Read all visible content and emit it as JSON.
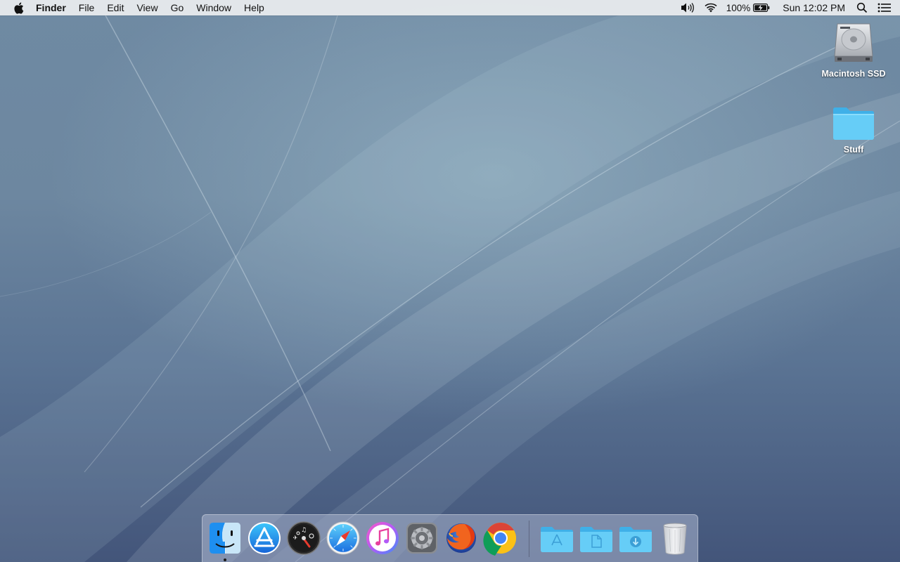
{
  "menubar": {
    "app_name": "Finder",
    "menus": [
      "File",
      "Edit",
      "View",
      "Go",
      "Window",
      "Help"
    ],
    "battery_percent": "100%",
    "clock": "Sun 12:02 PM",
    "icons": [
      "apple-icon",
      "volume-icon",
      "wifi-icon",
      "battery-charging-icon",
      "spotlight-search-icon",
      "notification-center-icon"
    ]
  },
  "desktop": {
    "icons": [
      {
        "label": "Macintosh SSD",
        "icon": "hard-drive-icon"
      },
      {
        "label": "Stuff",
        "icon": "folder-icon"
      }
    ]
  },
  "dock": {
    "apps": [
      {
        "name": "Finder",
        "icon": "finder-icon",
        "running": true
      },
      {
        "name": "App Store",
        "icon": "app-store-icon",
        "running": false
      },
      {
        "name": "Dashboard",
        "icon": "dashboard-icon",
        "running": false
      },
      {
        "name": "Safari",
        "icon": "safari-icon",
        "running": false
      },
      {
        "name": "iTunes",
        "icon": "itunes-icon",
        "running": false
      },
      {
        "name": "System Preferences",
        "icon": "system-preferences-icon",
        "running": false
      },
      {
        "name": "Firefox",
        "icon": "firefox-icon",
        "running": false
      },
      {
        "name": "Chrome",
        "icon": "chrome-icon",
        "running": false
      }
    ],
    "folders": [
      {
        "name": "Applications",
        "icon": "applications-folder-icon"
      },
      {
        "name": "Documents",
        "icon": "documents-folder-icon"
      },
      {
        "name": "Downloads",
        "icon": "downloads-folder-icon"
      }
    ],
    "trash": {
      "name": "Trash",
      "icon": "trash-icon"
    }
  },
  "colors": {
    "menubar_bg": "#eceef0",
    "folder_blue": "#5ac8f5",
    "desktop_top": "#6f8aa3",
    "desktop_bottom": "#43557a"
  }
}
